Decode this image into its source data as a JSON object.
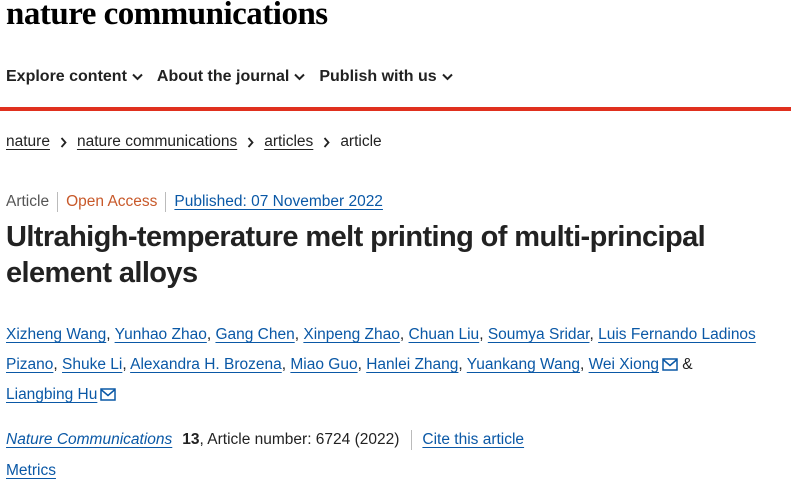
{
  "site": {
    "logo": "nature communications"
  },
  "nav": [
    {
      "label": "Explore content"
    },
    {
      "label": "About the journal"
    },
    {
      "label": "Publish with us"
    }
  ],
  "colors": {
    "accent": "#e0301e",
    "link": "#0a58a6",
    "open_access": "#c8592a"
  },
  "breadcrumb": [
    {
      "label": "nature"
    },
    {
      "label": "nature communications"
    },
    {
      "label": "articles"
    },
    {
      "label": "article"
    }
  ],
  "meta": {
    "type": "Article",
    "access": "Open Access",
    "published": "Published: 07 November 2022"
  },
  "title": "Ultrahigh-temperature melt printing of multi-principal element alloys",
  "authors": [
    "Xizheng Wang",
    "Yunhao Zhao",
    "Gang Chen",
    "Xinpeng Zhao",
    "Chuan Liu",
    "Soumya Sridar",
    "Luis Fernando Ladinos Pizano",
    "Shuke Li",
    "Alexandra H. Brozena",
    "Miao Guo",
    "Hanlei Zhang",
    "Yuankang Wang",
    "Wei Xiong",
    "Liangbing Hu"
  ],
  "author_joiner": "&",
  "citation": {
    "journal": "Nature Communications",
    "volume": "13",
    "details": ", Article number: 6724 (2022)",
    "cite_link": "Cite this article"
  },
  "metrics_label": "Metrics",
  "icons": {
    "dropdown": "chevron-down-icon",
    "breadcrumb_sep": "chevron-right-icon",
    "email": "mail-icon"
  }
}
